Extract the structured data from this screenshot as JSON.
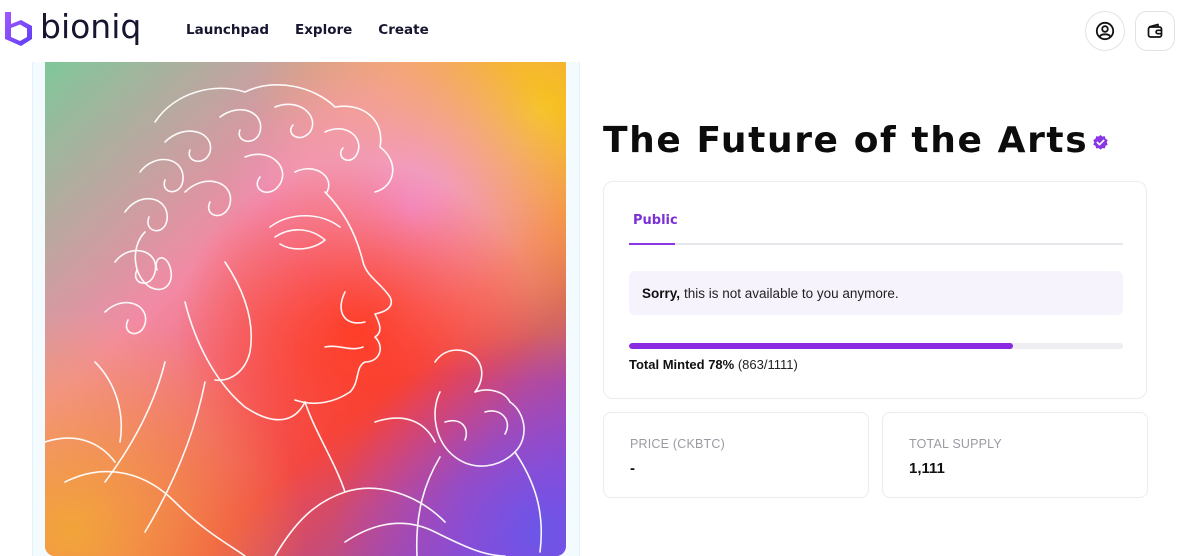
{
  "brand": {
    "name": "bioniq",
    "accent": "#8a2be2"
  },
  "nav": {
    "items": [
      "Launchpad",
      "Explore",
      "Create"
    ]
  },
  "header": {
    "profile_icon": "user-circle-icon",
    "wallet_icon": "wallet-icon"
  },
  "artwork": {
    "description_icon": "line-art-statue"
  },
  "collection": {
    "title": "The Future of the Arts",
    "verified_icon": "verified-badge-icon"
  },
  "mint": {
    "tab_label": "Public",
    "notice_bold": "Sorry,",
    "notice_text": "this is not available to you anymore.",
    "minted_label": "Total Minted 78%",
    "minted_count": "(863/1111)",
    "progress_fraction": 0.777
  },
  "stats": {
    "price_label": "PRICE (CKBTC)",
    "price_value": "-",
    "supply_label": "TOTAL SUPPLY",
    "supply_value": "1,111"
  }
}
